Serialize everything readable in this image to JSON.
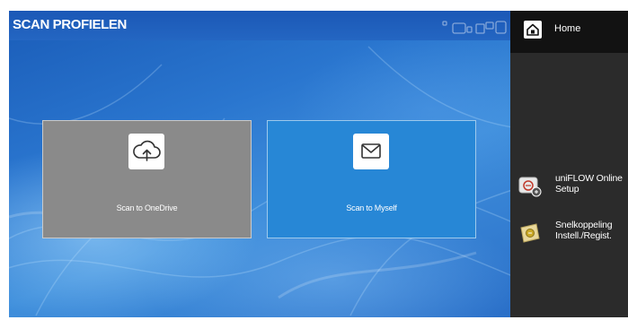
{
  "header": {
    "title": "SCAN PROFIELEN"
  },
  "tiles": [
    {
      "label": "Scan to OneDrive",
      "icon": "cloud-upload-icon",
      "color": "#8a8a8a"
    },
    {
      "label": "Scan to Myself",
      "icon": "envelope-icon",
      "color": "#2787d6"
    }
  ],
  "sidebar": {
    "home_label": "Home",
    "items": [
      {
        "line1": "uniFLOW Online",
        "line2": "Setup",
        "icon": "uniflow-setup-icon"
      },
      {
        "line1": "Snelkoppeling",
        "line2": "Instell./Regist.",
        "icon": "shortcut-icon"
      }
    ]
  },
  "colors": {
    "title_bar": "#1b58b6",
    "sidebar_bg": "#2b2b2b",
    "home_bar_bg": "#121212"
  }
}
